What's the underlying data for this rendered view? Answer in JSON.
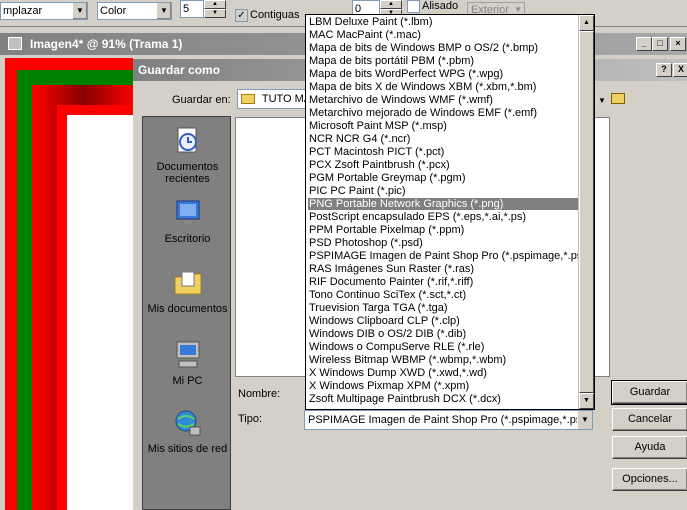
{
  "toolbar": {
    "mode_value": "mplazar",
    "color_value": "Color",
    "tolerance_value": "5",
    "contiguous_label": "Contiguas",
    "feather_value": "0",
    "antialias_label": "Alisado",
    "outside_label": "Exterior"
  },
  "image_window": {
    "title": "Imagen4* @  91% (Trama 1)"
  },
  "dialog": {
    "title": "Guardar como",
    "help_label": "?",
    "close_label": "X",
    "save_in_label": "Guardar en:",
    "save_in_value": "TUTO MA",
    "name_label": "Nombre:",
    "type_label": "Tipo:",
    "type_value": "PSPIMAGE Imagen de Paint Shop Pro (*.pspimage,*.psp",
    "buttons": {
      "save": "Guardar",
      "cancel": "Cancelar",
      "help": "Ayuda",
      "options": "Opciones..."
    },
    "places": [
      {
        "label": "Documentos recientes"
      },
      {
        "label": "Escritorio"
      },
      {
        "label": "Mis documentos"
      },
      {
        "label": "Mi PC"
      },
      {
        "label": "Mis sitios de red"
      }
    ]
  },
  "file_types": [
    "LBM Deluxe Paint (*.lbm)",
    "MAC MacPaint (*.mac)",
    "Mapa de bits de Windows BMP o OS/2 (*.bmp)",
    "Mapa de bits portátil PBM (*.pbm)",
    "Mapa de bits WordPerfect WPG (*.wpg)",
    "Mapa de bits X de Windows XBM (*.xbm,*.bm)",
    "Metarchivo de Windows WMF (*.wmf)",
    "Metarchivo mejorado de Windows EMF (*.emf)",
    "Microsoft Paint MSP (*.msp)",
    "NCR NCR G4 (*.ncr)",
    "PCT Macintosh PICT (*.pct)",
    "PCX Zsoft Paintbrush (*.pcx)",
    "PGM Portable Greymap (*.pgm)",
    "PIC PC Paint (*.pic)",
    "PNG Portable Network Graphics (*.png)",
    "PostScript encapsulado EPS (*.eps,*.ai,*.ps)",
    "PPM Portable Pixelmap (*.ppm)",
    "PSD Photoshop (*.psd)",
    "PSPIMAGE Imagen de Paint Shop Pro (*.pspimage,*.psp,",
    "RAS Imágenes Sun Raster (*.ras)",
    "RIF Documento Painter (*.rif,*.riff)",
    "Tono Continuo SciTex (*.sct,*.ct)",
    "Truevision Targa TGA (*.tga)",
    "Windows Clipboard CLP (*.clp)",
    "Windows DIB o OS/2 DIB (*.dib)",
    "Windows o CompuServe RLE (*.rle)",
    "Wireless Bitmap WBMP  (*.wbmp,*.wbm)",
    "X Windows Dump XWD (*.xwd,*.wd)",
    "X Windows Pixmap XPM (*.xpm)",
    "Zsoft Multipage Paintbrush DCX  (*.dcx)"
  ],
  "selected_file_type_index": 14
}
